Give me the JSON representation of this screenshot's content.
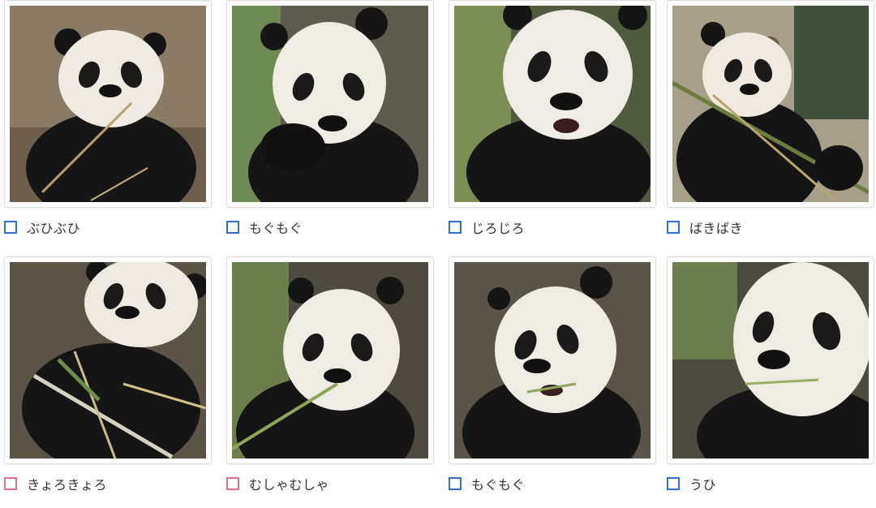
{
  "colors": {
    "checkbox_blue": "#2f6fd6",
    "checkbox_pink": "#e0708c",
    "label_text": "#333333"
  },
  "cards": [
    {
      "label": "ぶひぶひ",
      "checkbox_color": "blue",
      "image": "panda-eating-bamboo-photo"
    },
    {
      "label": "もぐもぐ",
      "checkbox_color": "blue",
      "image": "panda-chewing-photo"
    },
    {
      "label": "じろじろ",
      "checkbox_color": "blue",
      "image": "panda-staring-photo"
    },
    {
      "label": "ばきばき",
      "checkbox_color": "blue",
      "image": "panda-with-bamboo-stalk-photo"
    },
    {
      "label": "きょろきょろ",
      "checkbox_color": "pink",
      "image": "panda-looking-around-photo"
    },
    {
      "label": "むしゃむしゃ",
      "checkbox_color": "pink",
      "image": "panda-munching-photo"
    },
    {
      "label": "もぐもぐ",
      "checkbox_color": "blue",
      "image": "panda-chewing-leaves-photo"
    },
    {
      "label": "うひ",
      "checkbox_color": "blue",
      "image": "panda-closeup-photo"
    }
  ]
}
